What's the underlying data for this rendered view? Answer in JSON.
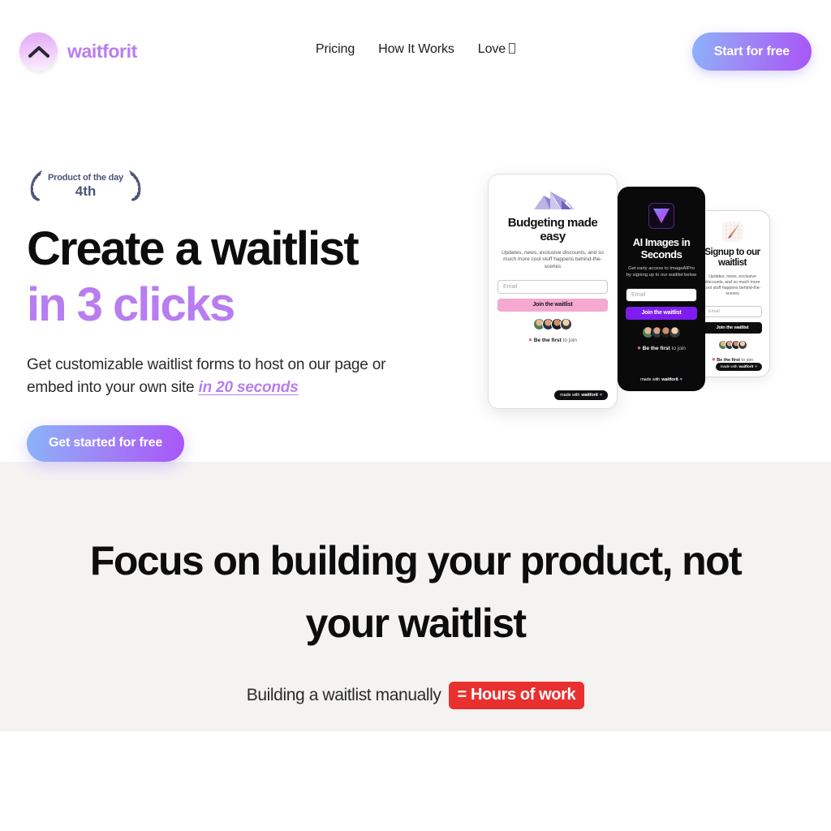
{
  "header": {
    "brand_name": "waitforit",
    "logo_icon": "chevron-up-icon",
    "nav": [
      {
        "label": "Pricing"
      },
      {
        "label": "How It Works"
      },
      {
        "label": "Love",
        "has_emoji_glyph": true
      }
    ],
    "cta_label": "Start for free"
  },
  "hero": {
    "badge": {
      "line1": "Product of the day",
      "line2": "4th",
      "icon": "laurel-wreath-icon",
      "color": "#4a5578"
    },
    "headline_line1": "Create a waitlist",
    "headline_line2": "in 3 clicks",
    "subhead_part1": "Get customizable waitlist forms to host on our page or embed into your own site ",
    "subhead_highlight": "in 20 seconds",
    "cta_label": "Get started for free",
    "accent_color": "#b87df0"
  },
  "mockups": [
    {
      "id": "card-budgeting",
      "theme": "light",
      "icon": "mountain-icon",
      "title": "Budgeting made easy",
      "subtitle": "Updates, news, exclusive discounts, and so much more cool stuff happens behind-the-scenes",
      "input_placeholder": "Email",
      "button_label": "Join the waitlist",
      "button_color": "#f5a8d0",
      "social_proof_bold": "Be the first",
      "social_proof_rest": " to join",
      "footer_prefix": "made with ",
      "footer_brand": "waitforit",
      "footer_heart": "♥"
    },
    {
      "id": "card-ai-images",
      "theme": "dark",
      "icon": "triangle-logo-icon",
      "title": "AI Images in Seconds",
      "subtitle": "Get early access to ImageAIPro by signing up to our waitlist below",
      "input_placeholder": "Email",
      "button_label": "Join the waitlist",
      "button_color": "#7d1df0",
      "social_proof_bold": "Be the first",
      "social_proof_rest": " to join",
      "footer_prefix": "made with ",
      "footer_brand": "waitforit",
      "footer_heart": "♥"
    },
    {
      "id": "card-signup",
      "theme": "light",
      "icon": "pen-writing-icon",
      "title": "Signup to our waitlist",
      "subtitle": "Updates, news, exclusive discounts, and so much more cool stuff happens behind-the-scenes",
      "input_placeholder": "Email",
      "button_label": "Join the waitlist",
      "button_color": "#0d0d0d",
      "social_proof_bold": "Be the first",
      "social_proof_rest": " to join",
      "footer_prefix": "made with ",
      "footer_brand": "waitforit",
      "footer_heart": "♥"
    }
  ],
  "section2": {
    "title": "Focus on building your product, not your waitlist",
    "compare_label": "Building a waitlist manually",
    "compare_badge": "= Hours of work",
    "badge_color": "#e8302f",
    "background": "#f4f3f2"
  }
}
